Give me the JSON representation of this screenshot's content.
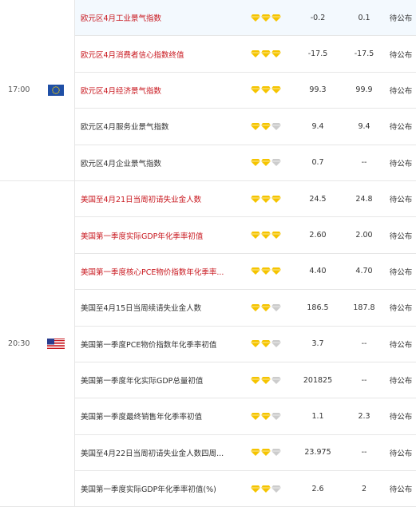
{
  "groups": [
    {
      "time": "17:00",
      "flag": "eu-flag-icon",
      "rows": [
        {
          "name": "欧元区4月工业景气指数",
          "red": true,
          "stars": 3,
          "previous": "-0.2",
          "forecast": "0.1",
          "actual": "待公布",
          "highlight": true
        },
        {
          "name": "欧元区4月消费者信心指数终值",
          "red": true,
          "stars": 3,
          "previous": "-17.5",
          "forecast": "-17.5",
          "actual": "待公布",
          "highlight": false
        },
        {
          "name": "欧元区4月经济景气指数",
          "red": true,
          "stars": 3,
          "previous": "99.3",
          "forecast": "99.9",
          "actual": "待公布",
          "highlight": false
        },
        {
          "name": "欧元区4月服务业景气指数",
          "red": false,
          "stars": 2,
          "previous": "9.4",
          "forecast": "9.4",
          "actual": "待公布",
          "highlight": false
        },
        {
          "name": "欧元区4月企业景气指数",
          "red": false,
          "stars": 2,
          "previous": "0.7",
          "forecast": "--",
          "actual": "待公布",
          "highlight": false
        }
      ]
    },
    {
      "time": "20:30",
      "flag": "us-flag-icon",
      "rows": [
        {
          "name": "美国至4月21日当周初请失业金人数",
          "red": true,
          "stars": 3,
          "previous": "24.5",
          "forecast": "24.8",
          "actual": "待公布",
          "highlight": false
        },
        {
          "name": "美国第一季度实际GDP年化季率初值",
          "red": true,
          "stars": 3,
          "previous": "2.60",
          "forecast": "2.00",
          "actual": "待公布",
          "highlight": false
        },
        {
          "name": "美国第一季度核心PCE物价指数年化季率...",
          "red": true,
          "stars": 3,
          "previous": "4.40",
          "forecast": "4.70",
          "actual": "待公布",
          "highlight": false
        },
        {
          "name": "美国至4月15日当周续请失业金人数",
          "red": false,
          "stars": 2,
          "previous": "186.5",
          "forecast": "187.8",
          "actual": "待公布",
          "highlight": false
        },
        {
          "name": "美国第一季度PCE物价指数年化季率初值",
          "red": false,
          "stars": 2,
          "previous": "3.7",
          "forecast": "--",
          "actual": "待公布",
          "highlight": false
        },
        {
          "name": "美国第一季度年化实际GDP总量初值",
          "red": false,
          "stars": 2,
          "previous": "201825",
          "forecast": "--",
          "actual": "待公布",
          "highlight": false
        },
        {
          "name": "美国第一季度最终销售年化季率初值",
          "red": false,
          "stars": 2,
          "previous": "1.1",
          "forecast": "2.3",
          "actual": "待公布",
          "highlight": false
        },
        {
          "name": "美国至4月22日当周初请失业金人数四周...",
          "red": false,
          "stars": 2,
          "previous": "23.975",
          "forecast": "--",
          "actual": "待公布",
          "highlight": false
        },
        {
          "name": "美国第一季度实际GDP年化季率初值(%)",
          "red": false,
          "stars": 2,
          "previous": "2.6",
          "forecast": "2",
          "actual": "待公布",
          "highlight": false
        }
      ]
    }
  ],
  "colors": {
    "star_on": "#f5c400",
    "star_off": "#cccccc",
    "red": "#c8161d"
  }
}
